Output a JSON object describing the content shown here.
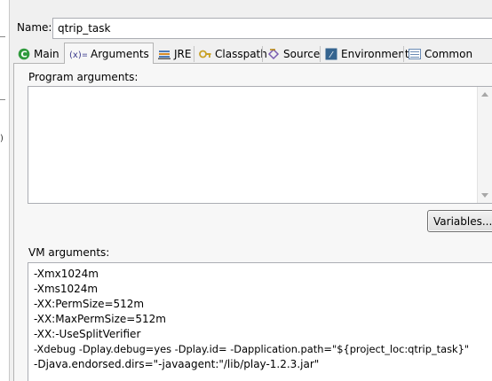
{
  "config": {
    "name_label": "Name:",
    "name_value": "qtrip_task"
  },
  "tabs": [
    {
      "label": "Main",
      "icon": "main-c-icon",
      "active": false
    },
    {
      "label": "Arguments",
      "icon": "arguments-icon",
      "active": true
    },
    {
      "label": "JRE",
      "icon": "jre-icon",
      "active": false
    },
    {
      "label": "Classpath",
      "icon": "classpath-icon",
      "active": false
    },
    {
      "label": "Source",
      "icon": "source-icon",
      "active": false
    },
    {
      "label": "Environment",
      "icon": "environment-icon",
      "active": false
    },
    {
      "label": "Common",
      "icon": "common-icon",
      "active": false
    }
  ],
  "arguments_tab": {
    "program_args_label": "Program arguments:",
    "program_args_value": "",
    "variables_button": "Variables...",
    "vm_args_label": "VM arguments:",
    "vm_args_lines": [
      "-Xmx1024m",
      "-Xms1024m",
      "-XX:PermSize=512m",
      "-XX:MaxPermSize=512m",
      "-XX:-UseSplitVerifier",
      "-Xdebug -Dplay.debug=yes -Dplay.id= -Dapplication.path=\"${project_loc:qtrip_task}\"",
      "-Djava.endorsed.dirs=\"-javaagent:\"/lib/play-1.2.3.jar\""
    ]
  },
  "left_strip_glyph": ")",
  "colors": {
    "window_bg": "#f0f0f0",
    "panel_bg": "#f7f7f7",
    "border": "#b4b4b4",
    "input_border": "#abadb3",
    "main_icon_green": "#2f9a3c",
    "environment_icon_blue": "#35648f"
  }
}
